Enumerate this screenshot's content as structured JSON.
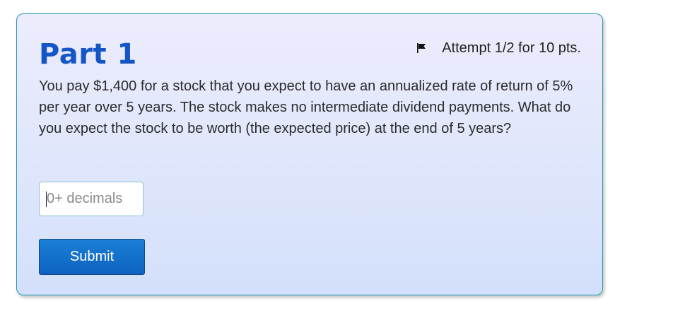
{
  "part": {
    "title": "Part 1",
    "attempt_text": "Attempt 1/2 for 10 pts.",
    "flag_icon": "flag-icon",
    "question": "You pay $1,400 for a stock that you expect to have an annualized rate of return of 5% per year over 5 years. The stock makes no intermediate dividend payments. What do you expect the stock to be worth (the expected price) at the end of 5 years?",
    "answer": {
      "value": "",
      "placeholder": "0+ decimals"
    },
    "submit_label": "Submit"
  },
  "colors": {
    "title": "#1556c6",
    "card_border": "#1e9bb0",
    "button": "#0d63bf"
  }
}
